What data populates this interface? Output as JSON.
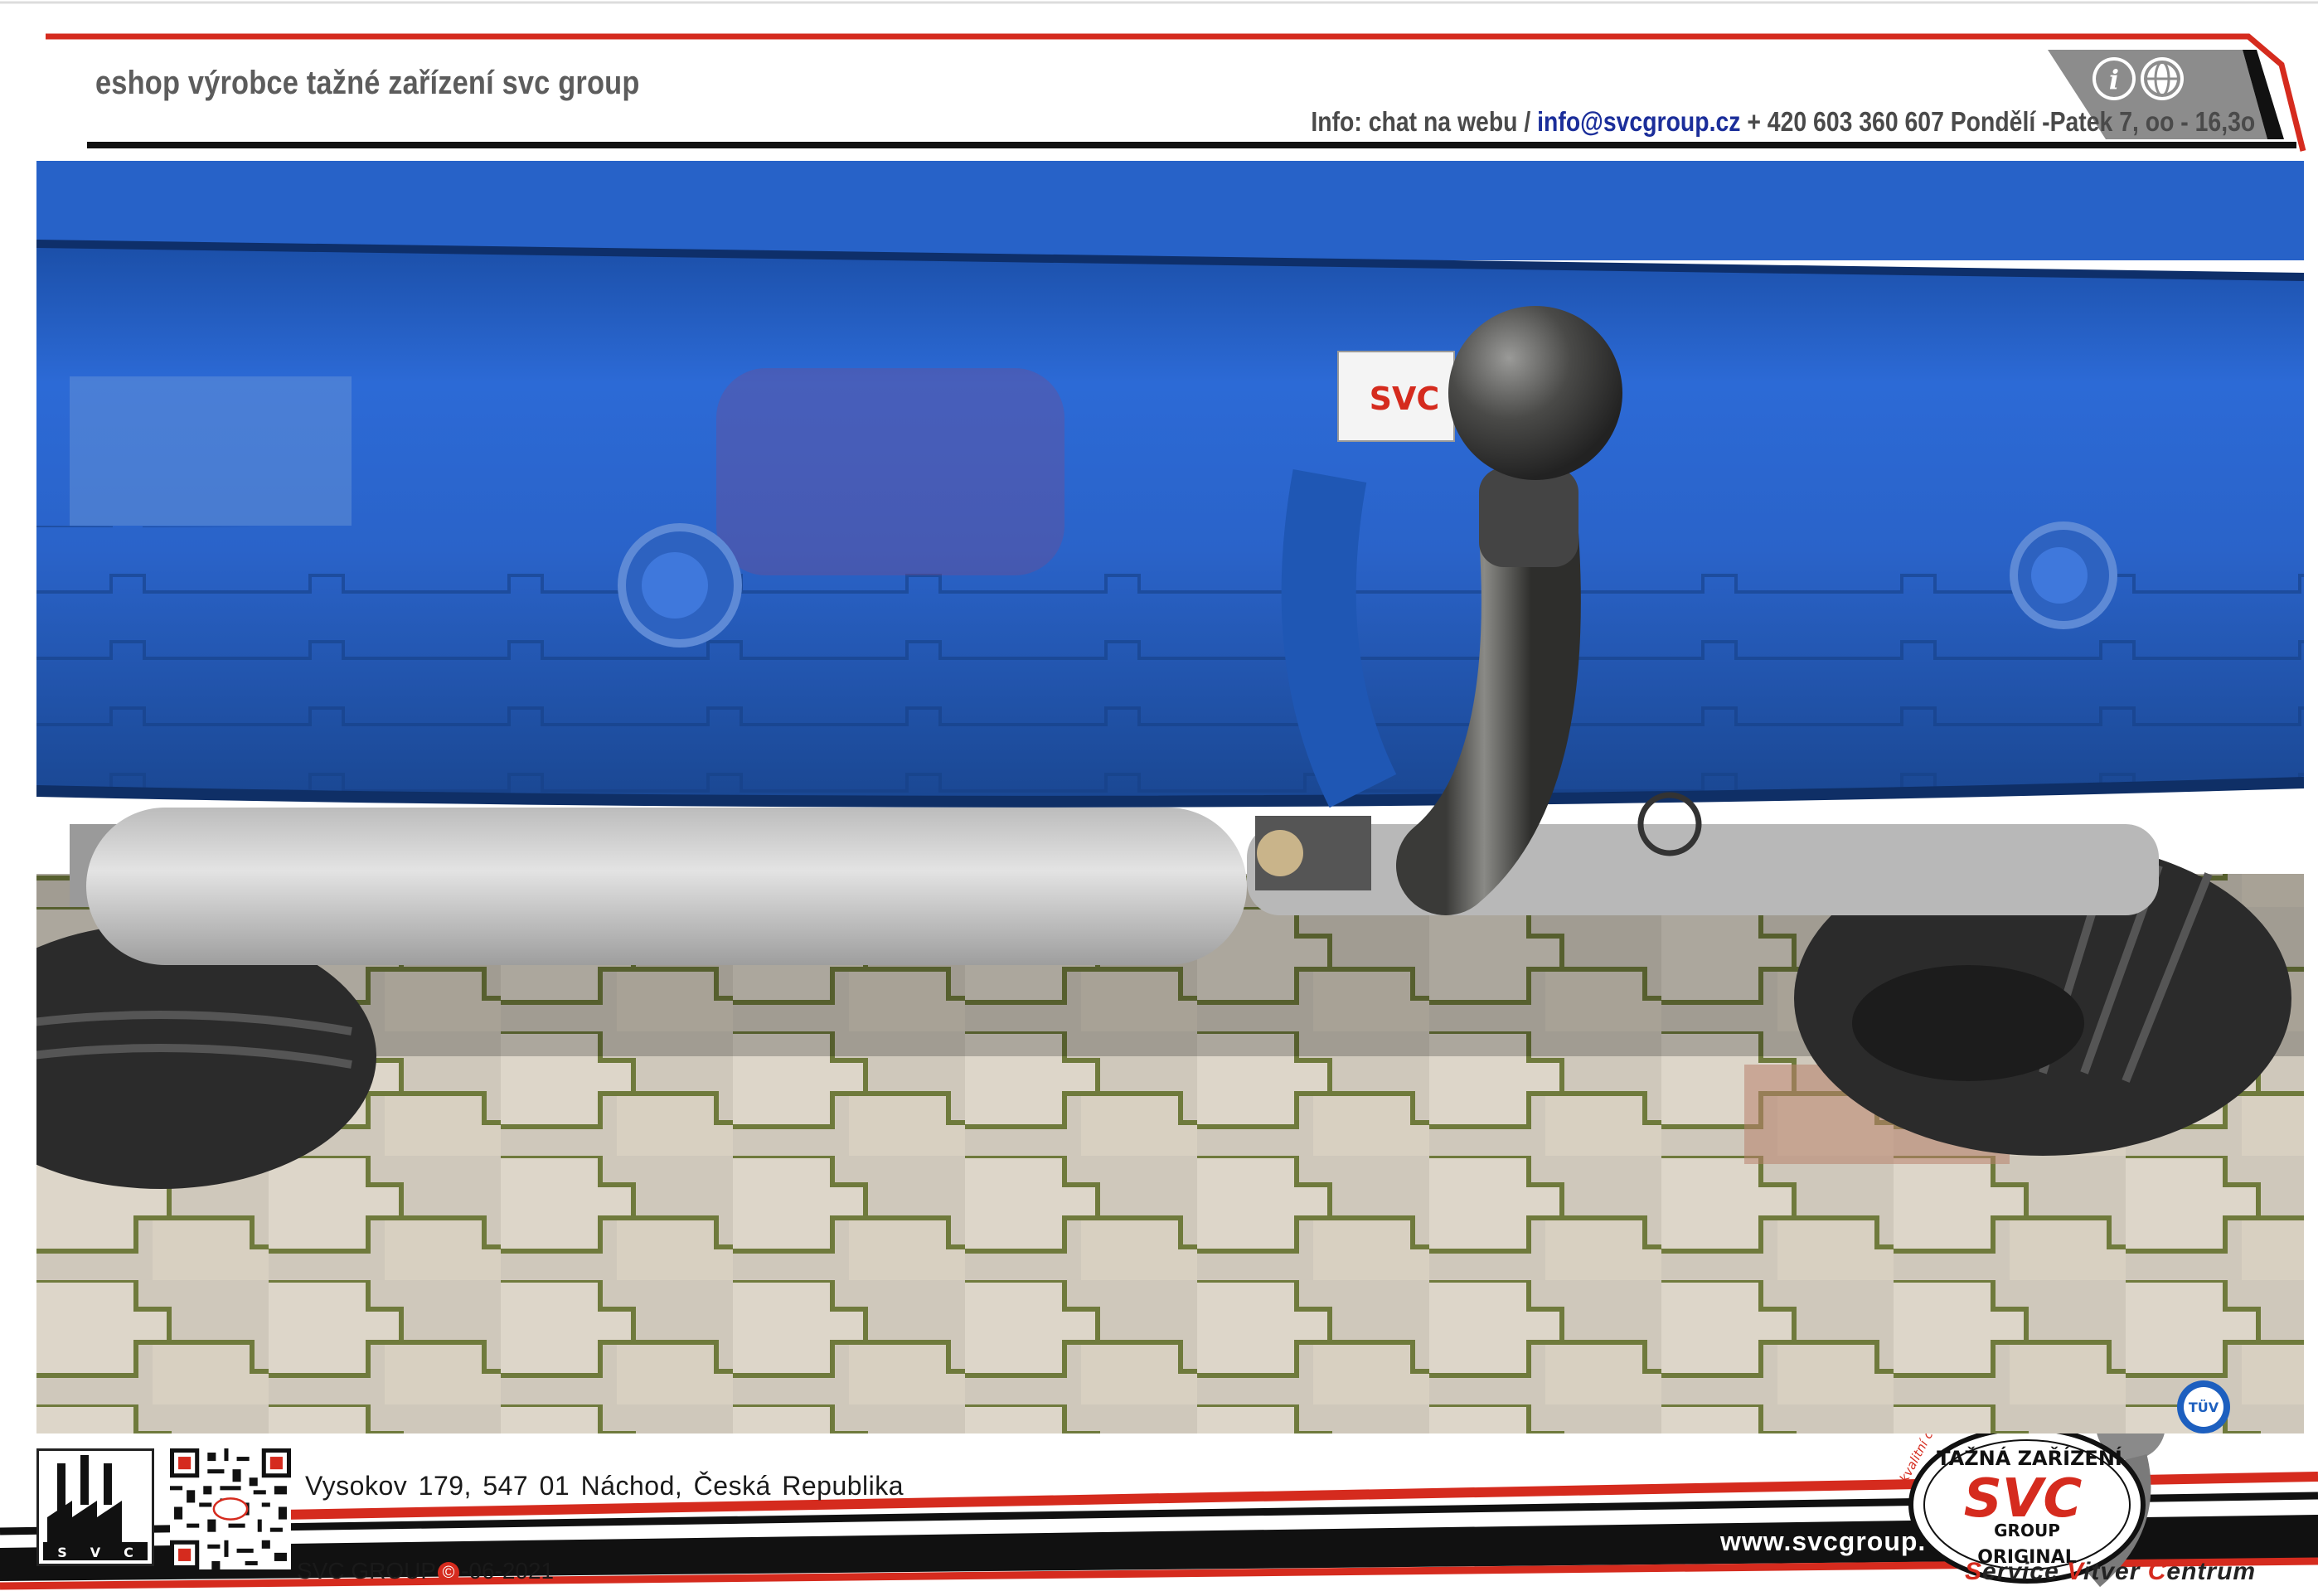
{
  "header": {
    "site_title": "eshop výrobce tažné zařízení svc group",
    "contact_prefix": "Info: chat na webu /",
    "contact_email": "info@svcgroup.cz",
    "contact_suffix": "+ 420 603 360 607 Pondělí -Patek  7, oo - 16,3o",
    "icons": [
      "info-icon",
      "globe-icon"
    ]
  },
  "photo": {
    "sticker_text": "SVC"
  },
  "footer": {
    "factory_logo_letters": [
      "S",
      "V",
      "C"
    ],
    "address": "Vysokov 179,  547 01 Náchod,  Česká Republika",
    "copyright_before": "SVC GROUP",
    "copyright_symbol": "©",
    "copyright_after": "-06-2021",
    "website": "www.svcgroup.cz",
    "badge": {
      "top": "TAŽNÁ ZAŘÍZENÍ",
      "brand": "SVC",
      "middle": "GROUP",
      "bottom": "ORIGINAL",
      "side": "kvalitní čeština",
      "tuv": "TÜV"
    },
    "service_words": [
      {
        "first": "S",
        "rest": "ervice "
      },
      {
        "first": "V",
        "rest": "itver "
      },
      {
        "first": "C",
        "rest": "entrum"
      }
    ]
  },
  "colors": {
    "accent_red": "#d52b1e",
    "dark": "#1a1a1a",
    "car_blue": "#1f5fc4",
    "email_blue": "#1b2e9a"
  }
}
